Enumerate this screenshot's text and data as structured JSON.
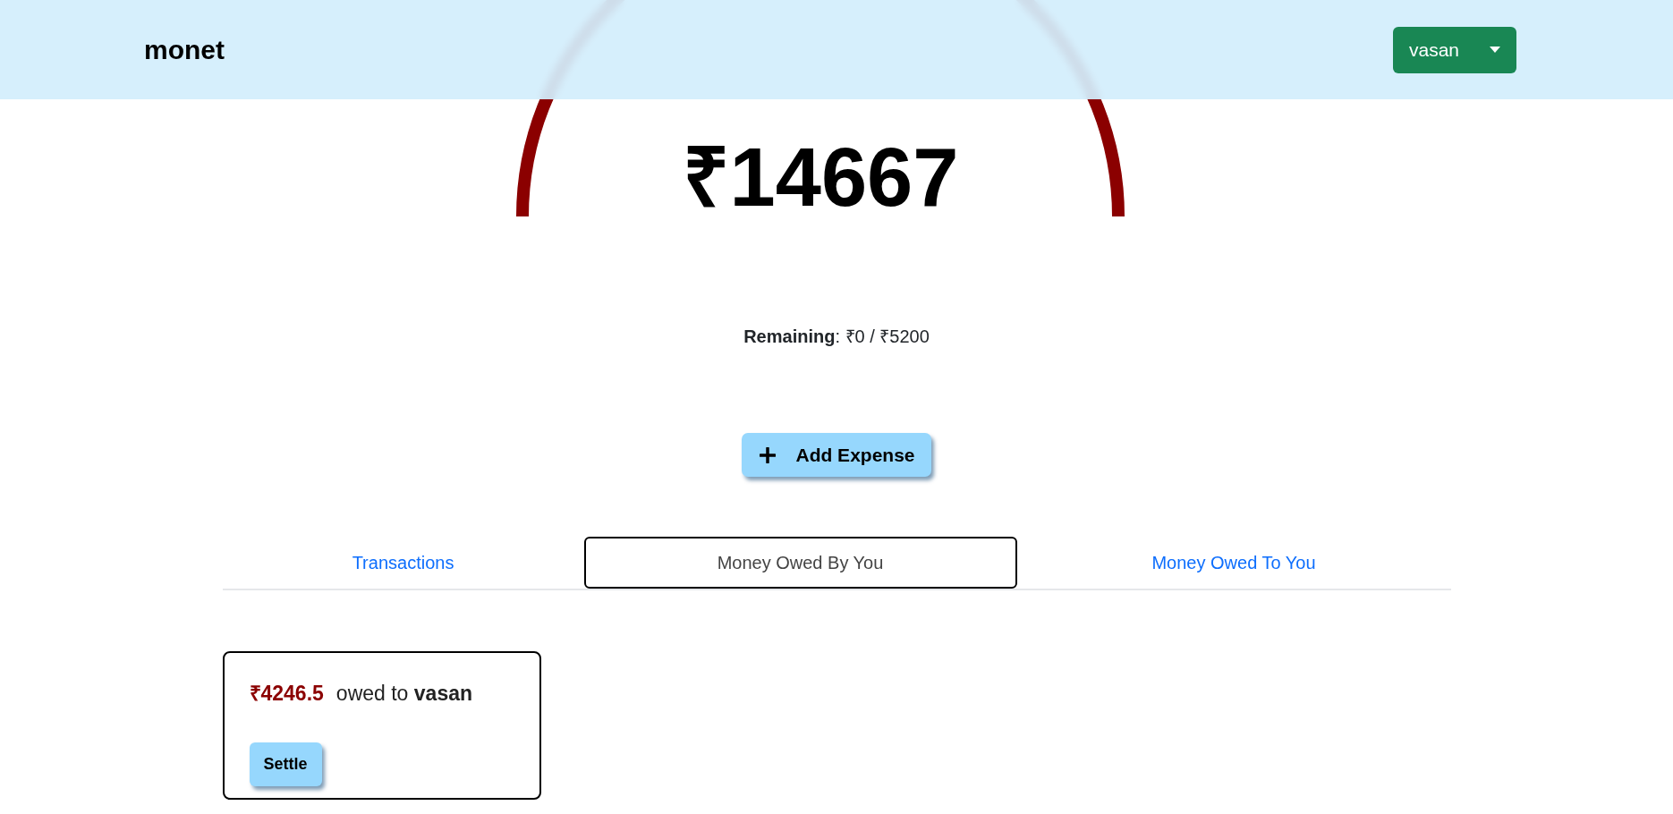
{
  "header": {
    "logo": "monet",
    "user_menu": {
      "label": "vasan"
    }
  },
  "gauge": {
    "amount": "₹14667"
  },
  "remaining": "**Remaining**: ₹0 / ₹5200",
  "add_button": {
    "label": "Add Expense"
  },
  "tabs": [
    {
      "label": "Transactions",
      "selected": false
    },
    {
      "label": "Money Owed By You",
      "selected": true
    },
    {
      "label": "Money Owed To You",
      "selected": false
    }
  ],
  "debts": [
    {
      "amount": "₹4246.5",
      "text": "owed to **vasan**",
      "button": "Settle"
    }
  ]
}
